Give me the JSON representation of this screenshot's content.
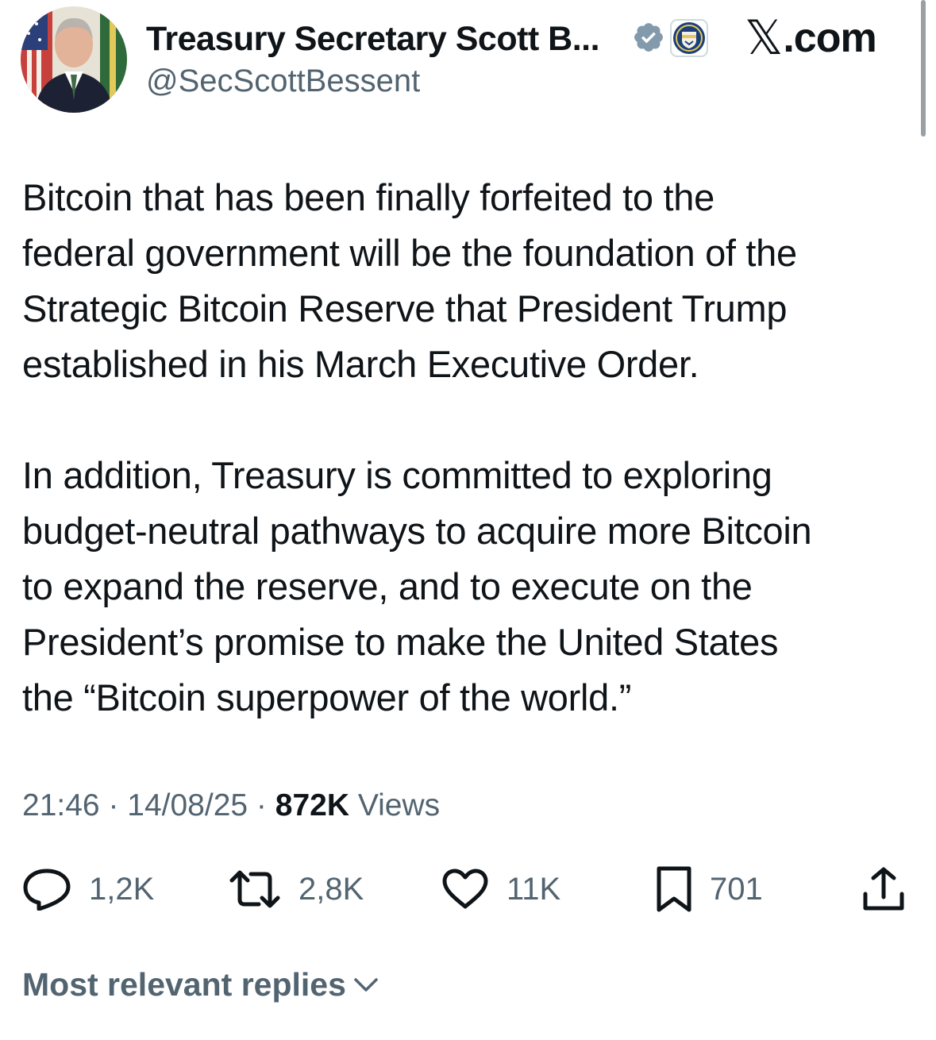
{
  "author": {
    "display_name": "Treasury Secretary Scott B...",
    "handle": "@SecScottBessent"
  },
  "site_logo": {
    "mark": "𝕏",
    "suffix": ".com"
  },
  "tweet": {
    "text": "Bitcoin that has been finally forfeited to the\nfederal government will be the foundation of the\nStrategic Bitcoin Reserve that President Trump\nestablished in his March Executive Order.\n\nIn addition, Treasury is committed to exploring\nbudget-neutral pathways to acquire more Bitcoin\nto expand the reserve, and to execute on the\nPresident’s promise to make the United States\nthe “Bitcoin superpower of the world.”",
    "time": "21:46",
    "date": "14/08/25",
    "separator": " · ",
    "views_count": "872K",
    "views_label": " Views"
  },
  "actions": {
    "replies": "1,2K",
    "reposts": "2,8K",
    "likes": "11K",
    "bookmarks": "701"
  },
  "replies_sort": {
    "label": "Most relevant replies"
  },
  "colors": {
    "text": "#0f1419",
    "secondary": "#536471",
    "verified_badge": "#829aab",
    "background": "#ffffff"
  },
  "icons": [
    "verified-badge-icon",
    "treasury-seal-icon",
    "reply-icon",
    "repost-icon",
    "like-icon",
    "bookmark-icon",
    "share-icon",
    "chevron-down-icon"
  ]
}
